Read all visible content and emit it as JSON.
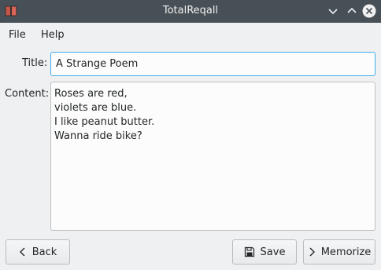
{
  "window": {
    "title": "TotalReqall",
    "icons": {
      "app": "book-icon",
      "minimize": "chevron-down-icon",
      "maximize": "chevron-up-icon",
      "close": "close-icon"
    }
  },
  "menu": {
    "file": "File",
    "help": "Help"
  },
  "form": {
    "title_label": "Title:",
    "title_value": "A Strange Poem",
    "content_label": "Content:",
    "content_value": "Roses are red,\nviolets are blue.\nI like peanut butter.\nWanna ride bike?"
  },
  "buttons": {
    "back": {
      "label": "Back",
      "icon": "chevron-left-icon"
    },
    "save": {
      "label": "Save",
      "icon": "floppy-disk-icon"
    },
    "memorize": {
      "label": "Memorize",
      "icon": "chevron-right-icon"
    }
  },
  "colors": {
    "titlebar": "#475057",
    "focus": "#3daee9",
    "background": "#eff0f1"
  }
}
